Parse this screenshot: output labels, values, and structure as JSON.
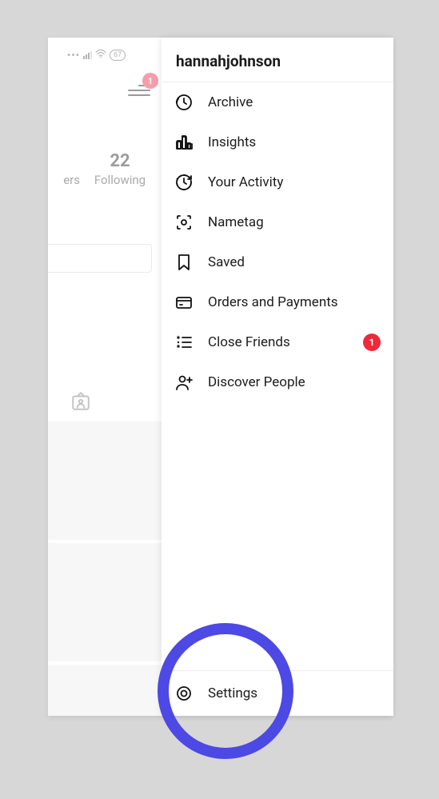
{
  "status": {
    "battery": "67"
  },
  "hamburger_badge": "1",
  "profile": {
    "followers_label_partial": "ers",
    "following_count": "22",
    "following_label": "Following"
  },
  "drawer": {
    "username": "hannahjohnson",
    "items": [
      {
        "label": "Archive"
      },
      {
        "label": "Insights"
      },
      {
        "label": "Your Activity"
      },
      {
        "label": "Nametag"
      },
      {
        "label": "Saved"
      },
      {
        "label": "Orders and Payments"
      },
      {
        "label": "Close Friends",
        "badge": "1"
      },
      {
        "label": "Discover People"
      }
    ],
    "settings_label": "Settings"
  }
}
